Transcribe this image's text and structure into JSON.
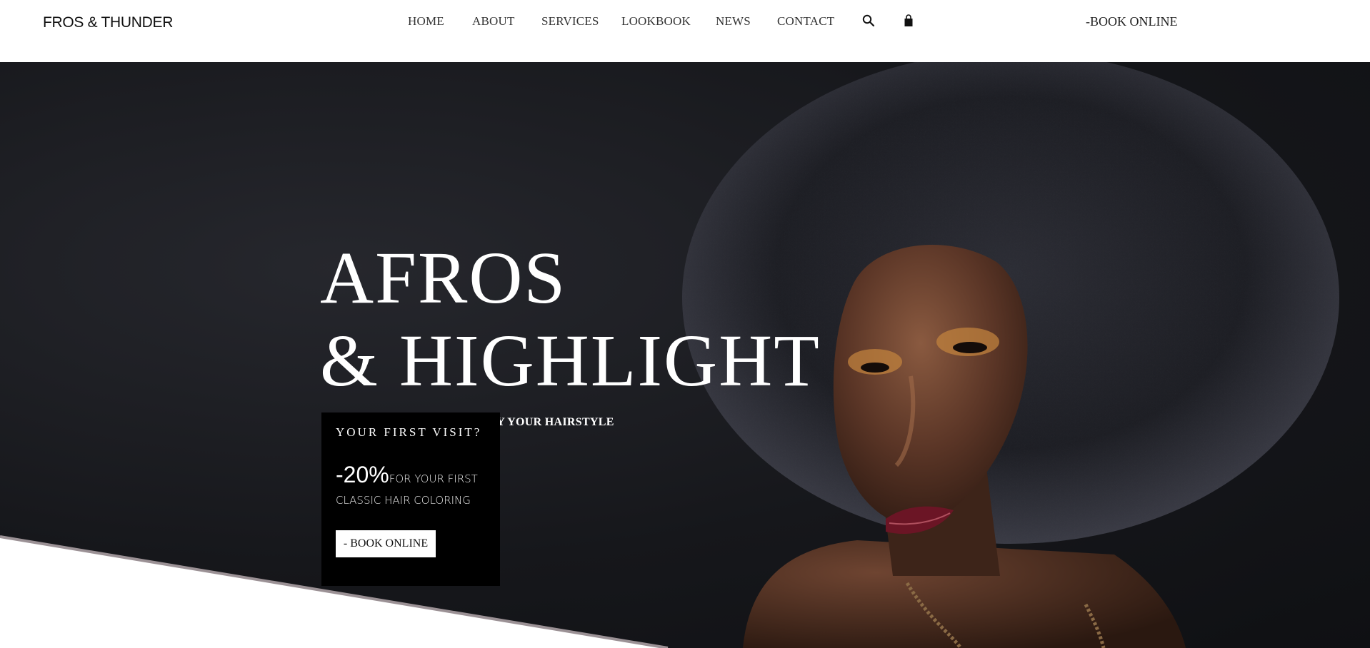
{
  "header": {
    "logo": "FROS & THUNDER",
    "nav": [
      "HOME",
      "ABOUT",
      "SERVICES",
      "LOOKBOOK",
      "NEWS",
      "CONTACT"
    ],
    "icons": [
      "search-icon",
      "shopping-bag-icon"
    ],
    "book_online": "-BOOK ONLINE"
  },
  "hero": {
    "headline_line1": "AFROS",
    "headline_line2": "& HIGHLIGHT",
    "tagline": "DIVIDE YOUR UNIQUENESS BY YOUR HAIRSTYLE",
    "image": "portrait-photo"
  },
  "promo": {
    "title": "YOUR FIRST VISIT?",
    "discount": "-20%",
    "description": "FOR YOUR FIRST CLASSIC HAIR COLORING",
    "button": "- BOOK ONLINE"
  },
  "colors": {
    "hero_background": "#16171b",
    "promo_background": "#000000",
    "header_background": "#ffffff",
    "text_light": "#ffffff",
    "wedge_edge": "#9b9195"
  }
}
